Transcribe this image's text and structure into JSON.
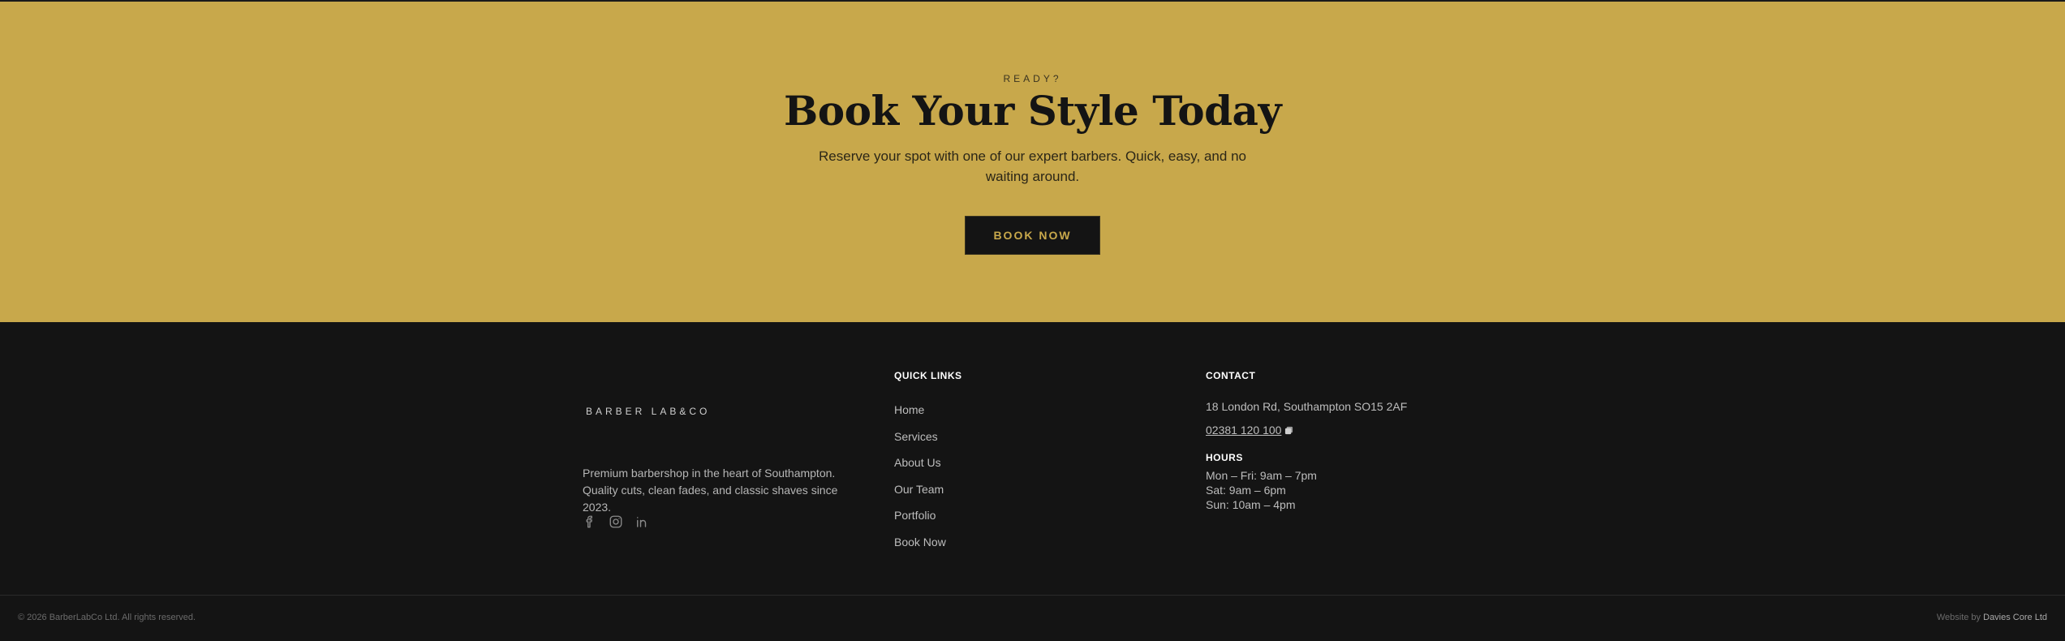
{
  "cta": {
    "eyebrow": "READY?",
    "title": "Book Your Style Today",
    "description": "Reserve your spot with one of our expert barbers. Quick, easy, and no waiting around.",
    "button_label": "BOOK NOW"
  },
  "footer": {
    "logo_text": "BARBER LAB&CO",
    "about": "Premium barbershop in the heart of Southampton. Quality cuts, clean fades, and classic shaves since 2023.",
    "social_icons": [
      "facebook-icon",
      "instagram-icon",
      "linkedin-icon"
    ],
    "quick_links": {
      "title": "QUICK LINKS",
      "items": [
        "Home",
        "Services",
        "About Us",
        "Our Team",
        "Portfolio",
        "Book Now"
      ]
    },
    "contact": {
      "title": "CONTACT",
      "address": "18 London Rd, Southampton SO15 2AF",
      "phone": "02381 120 100",
      "phone_icon": "copy-icon"
    },
    "hours": {
      "title": "HOURS",
      "items": [
        "Mon – Fri: 9am – 7pm",
        "Sat: 9am – 6pm",
        "Sun: 10am – 4pm"
      ]
    },
    "copyright": "© 2026 BarberLabCo Ltd. All rights reserved.",
    "credit_prefix": "Website by",
    "credit_link": "Davies Core Ltd"
  },
  "colors": {
    "gold": "#c8a84b",
    "dark": "#141414"
  }
}
